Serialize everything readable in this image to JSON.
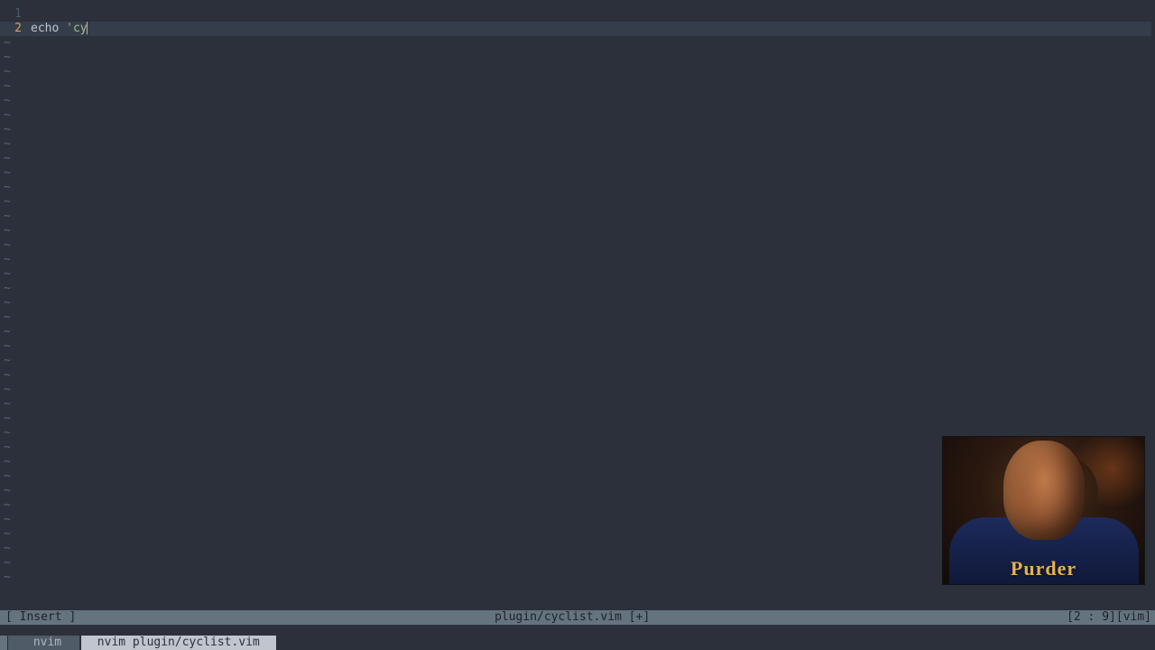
{
  "editor": {
    "lines": {
      "1": {
        "num": "1",
        "text": ""
      },
      "2": {
        "num": "2",
        "keyword": "echo ",
        "quote": "'",
        "string": "cy"
      }
    },
    "tilde": "~",
    "tilde_count": 38
  },
  "statusline": {
    "mode": "[ Insert ]",
    "file": "plugin/cyclist.vim [+]",
    "pos": "[2 : 9][vim]"
  },
  "tmux": {
    "inactive_window": " nvim ",
    "active_window": " nvim plugin/cyclist.vim "
  },
  "webcam": {
    "shirt": "Purder"
  }
}
